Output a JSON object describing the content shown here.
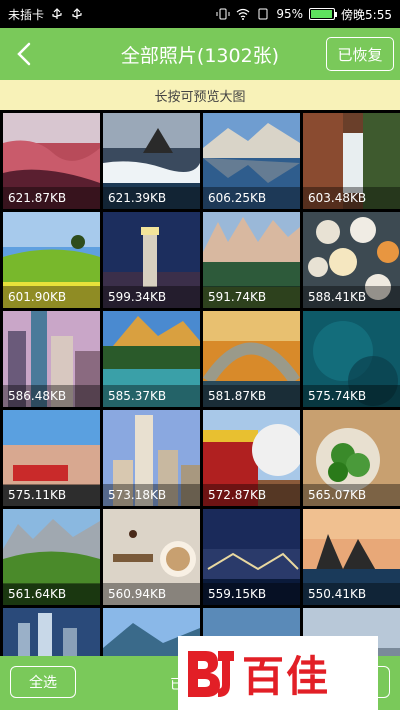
{
  "status_bar": {
    "carrier": "未插卡",
    "battery": "95%",
    "battery_level": 0.95,
    "time": "傍晚5:55"
  },
  "header": {
    "back_icon": "chevron-left-icon",
    "title": "全部照片(1302张)",
    "restored_button": "已恢复"
  },
  "hint": "长按可预览大图",
  "photos": [
    {
      "size": "621.87KB"
    },
    {
      "size": "621.39KB"
    },
    {
      "size": "606.25KB"
    },
    {
      "size": "603.48KB"
    },
    {
      "size": "601.90KB"
    },
    {
      "size": "599.34KB"
    },
    {
      "size": "591.74KB"
    },
    {
      "size": "588.41KB"
    },
    {
      "size": "586.48KB"
    },
    {
      "size": "585.37KB"
    },
    {
      "size": "581.87KB"
    },
    {
      "size": "575.74KB"
    },
    {
      "size": "575.11KB"
    },
    {
      "size": "573.18KB"
    },
    {
      "size": "572.87KB"
    },
    {
      "size": "565.07KB"
    },
    {
      "size": "561.64KB"
    },
    {
      "size": "560.94KB"
    },
    {
      "size": "559.15KB"
    },
    {
      "size": "550.41KB"
    }
  ],
  "bottom_bar": {
    "select_all": "全选",
    "partial": "已"
  },
  "watermark": {
    "text": "百佳"
  }
}
